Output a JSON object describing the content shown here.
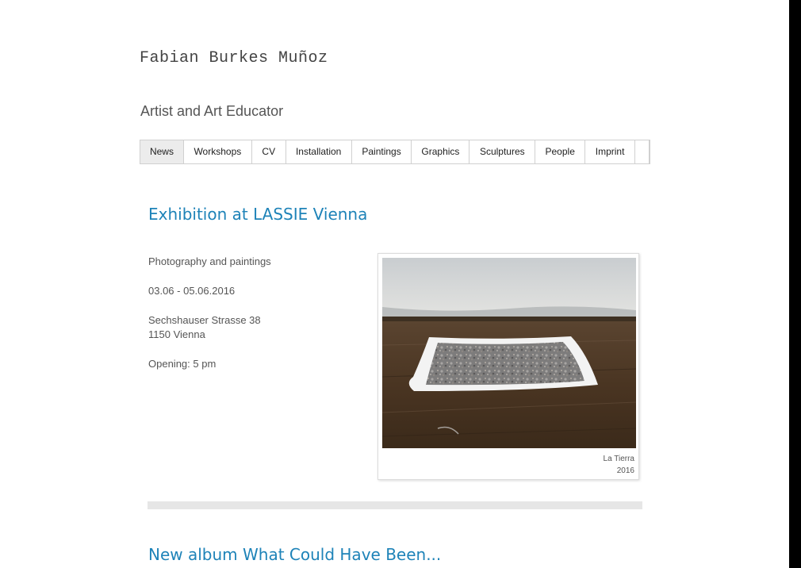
{
  "site": {
    "title": "Fabian Burkes Muñoz",
    "subtitle": "Artist and Art Educator"
  },
  "nav": {
    "items": [
      "News",
      "Workshops",
      "CV",
      "Installation",
      "Paintings",
      "Graphics",
      "Sculptures",
      "People",
      "Imprint"
    ],
    "active": "News"
  },
  "posts": [
    {
      "title": "Exhibition at LASSIE Vienna",
      "type": "Photography and paintings",
      "dates": "03.06 - 05.06.2016",
      "address_line1": "Sechshauser Strasse 38",
      "address_line2": "1150 Vienna",
      "opening": "Opening: 5 pm",
      "image_caption_title": "La Tierra",
      "image_caption_year": "2016"
    },
    {
      "title": "New album What Could Have Been..."
    }
  ],
  "colors": {
    "accent": "#1e83b8",
    "nav_active_bg": "#ececec"
  }
}
